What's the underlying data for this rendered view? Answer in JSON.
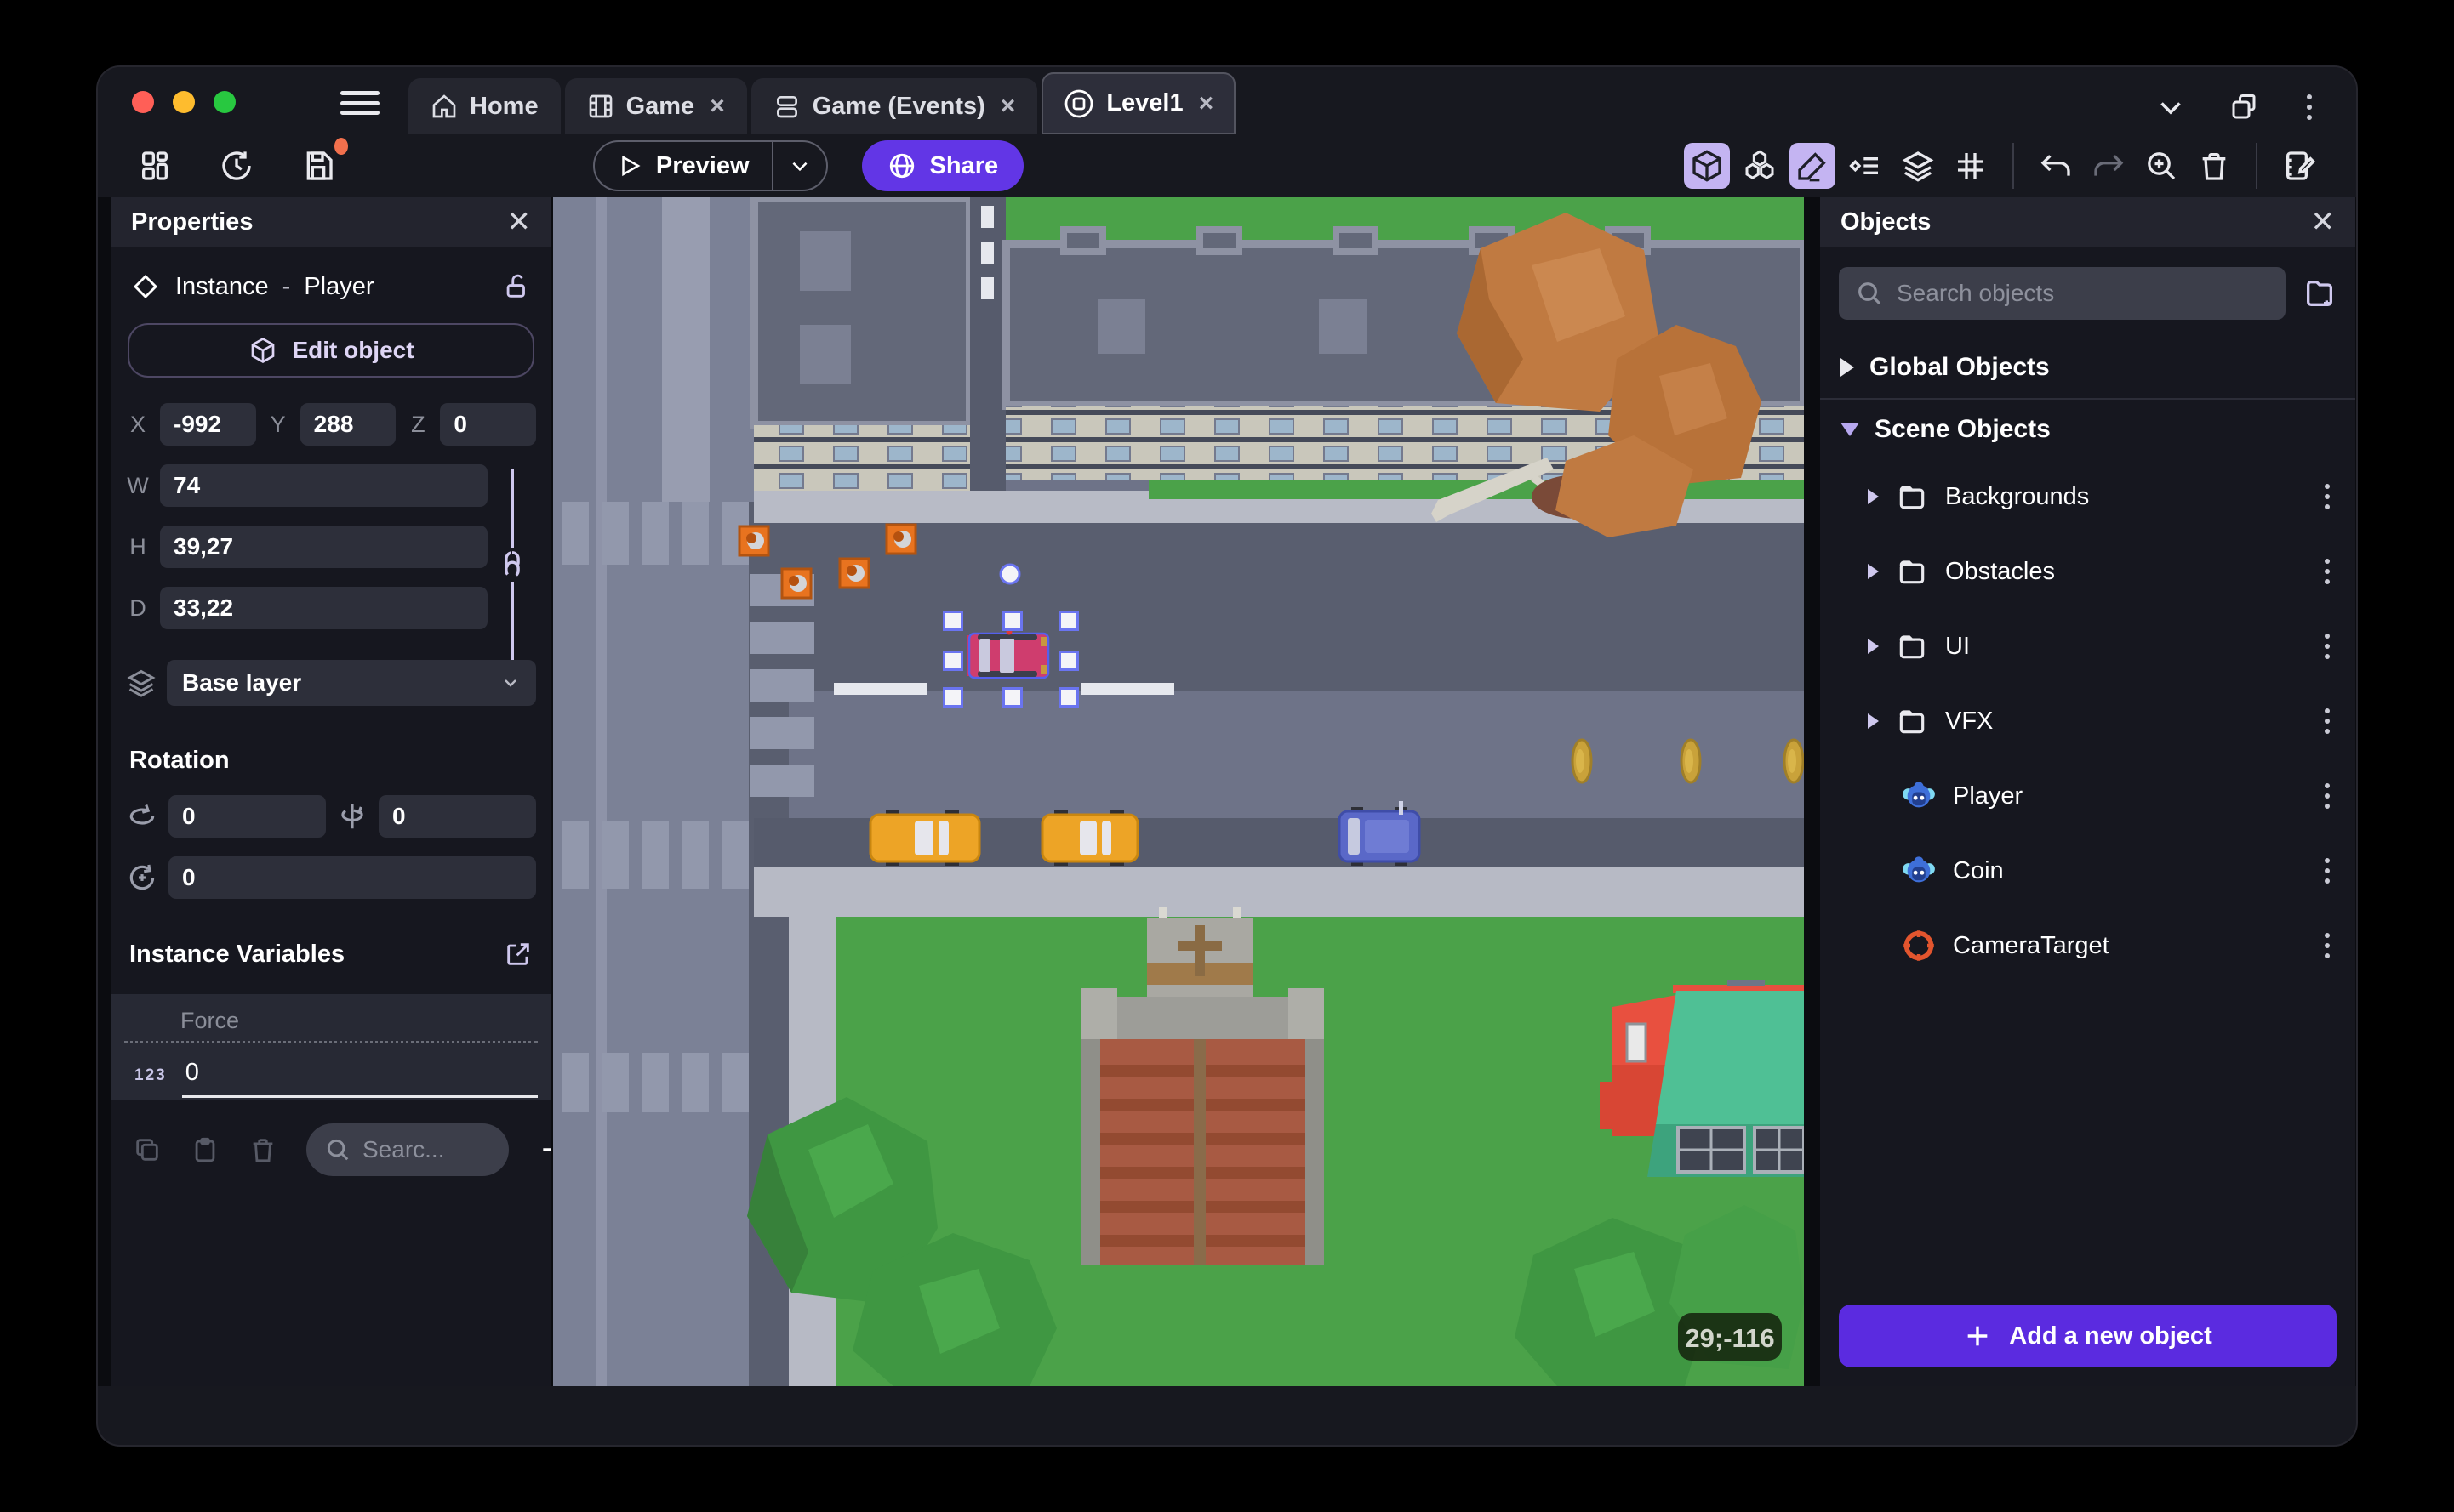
{
  "window": {
    "tabs": [
      {
        "label": "Home",
        "closable": false,
        "active": false
      },
      {
        "label": "Game",
        "closable": true,
        "active": false
      },
      {
        "label": "Game (Events)",
        "closable": true,
        "active": false
      },
      {
        "label": "Level1",
        "closable": true,
        "active": true
      }
    ],
    "close_glyph": "×"
  },
  "toolbar": {
    "preview_label": "Preview",
    "share_label": "Share"
  },
  "properties": {
    "title": "Properties",
    "instance_type": "Instance",
    "instance_separator": "-",
    "instance_name": "Player",
    "edit_object_label": "Edit object",
    "x_label": "X",
    "x_value": "-992",
    "y_label": "Y",
    "y_value": "288",
    "z_label": "Z",
    "z_value": "0",
    "w_label": "W",
    "w_value": "74",
    "h_label": "H",
    "h_value": "39,27",
    "d_label": "D",
    "d_value": "33,22",
    "layer_value": "Base layer",
    "rotation_title": "Rotation",
    "rotation_x": "0",
    "rotation_y": "0",
    "rotation_z": "0",
    "variables_title": "Instance Variables",
    "variables": [
      {
        "name": "Force",
        "type_badge": "123",
        "value": "0"
      }
    ],
    "variables_search_placeholder": "Searc..."
  },
  "objects_panel": {
    "title": "Objects",
    "search_placeholder": "Search objects",
    "global_group_label": "Global Objects",
    "scene_group_label": "Scene Objects",
    "folders": [
      "Backgrounds",
      "Obstacles",
      "UI",
      "VFX"
    ],
    "items": [
      {
        "name": "Player",
        "icon": "monkey"
      },
      {
        "name": "Coin",
        "icon": "monkey"
      },
      {
        "name": "CameraTarget",
        "icon": "target"
      }
    ],
    "add_button_label": "Add a new object"
  },
  "canvas": {
    "coordinates_badge": "29;-116",
    "selected_instance": "Player car (pink), 8 resize handles + rotate handle"
  },
  "colors": {
    "accent_purple": "#5b2be0",
    "share_purple": "#6236e6",
    "toolbar_highlight": "#c4b4f2",
    "panel_bg": "#16171f",
    "field_bg": "#2d2f3a",
    "road_light": "#7b8196",
    "road_dark": "#595e6f",
    "sidewalk": "#b8bbc6",
    "grass": "#4ba249",
    "selection_blue": "#6a74f0",
    "crate_orange": "#e8731f",
    "coin_gold": "#c9a23a",
    "camera_target_orange": "#e2552e"
  }
}
